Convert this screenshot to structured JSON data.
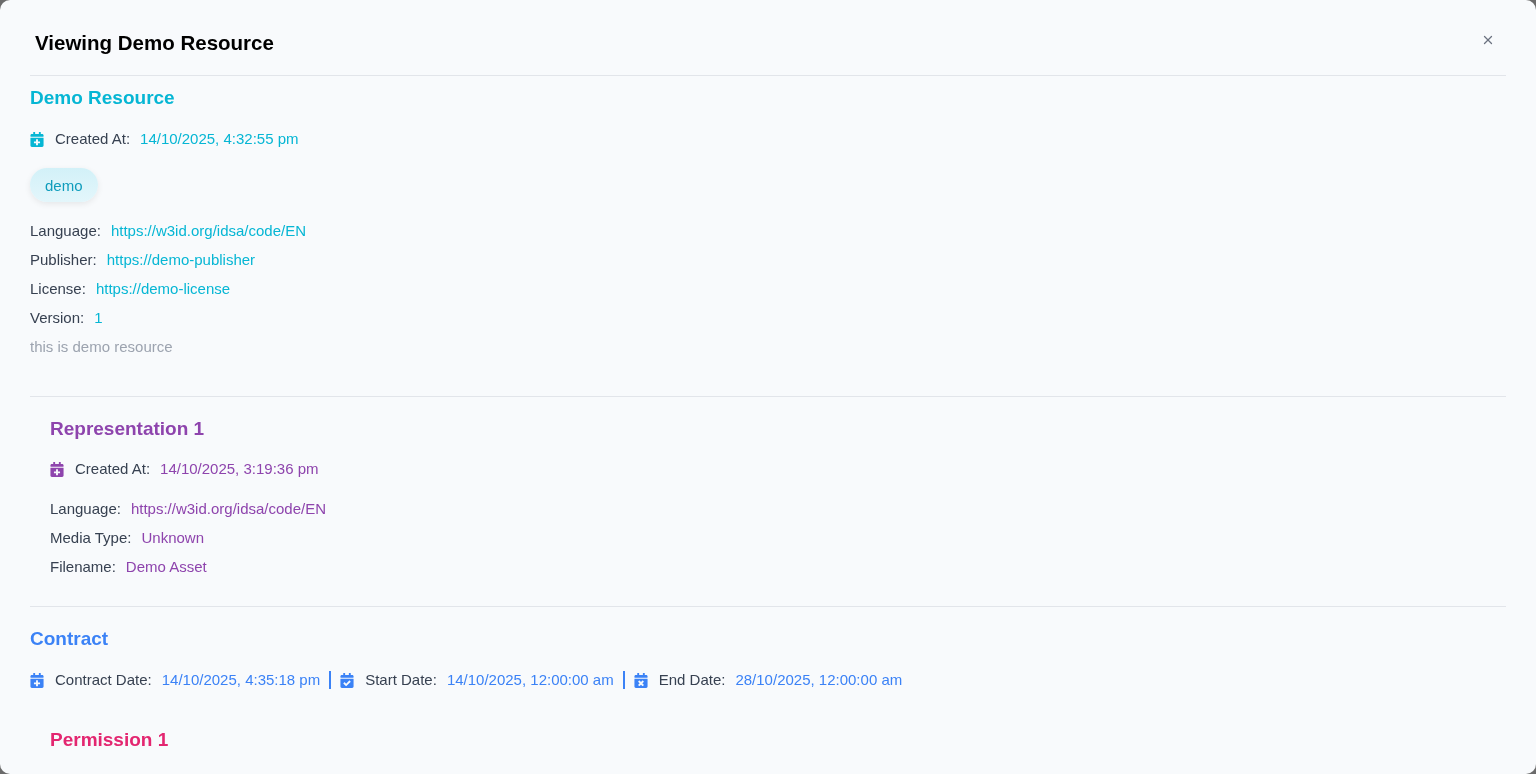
{
  "dialog": {
    "title": "Viewing Demo Resource"
  },
  "resource": {
    "title": "Demo Resource",
    "created": {
      "label": "Created At:",
      "value": "14/10/2025, 4:32:55 pm"
    },
    "tags": [
      "demo"
    ],
    "fields": [
      {
        "label": "Language:",
        "value": "https://w3id.org/idsa/code/EN"
      },
      {
        "label": "Publisher:",
        "value": "https://demo-publisher"
      },
      {
        "label": "License:",
        "value": "https://demo-license"
      },
      {
        "label": "Version:",
        "value": "1"
      }
    ],
    "description": "this is demo resource"
  },
  "representations": [
    {
      "title": "Representation 1",
      "created": {
        "label": "Created At:",
        "value": "14/10/2025, 3:19:36 pm"
      },
      "fields": [
        {
          "label": "Language:",
          "value": "https://w3id.org/idsa/code/EN"
        },
        {
          "label": "Media Type:",
          "value": "Unknown"
        },
        {
          "label": "Filename:",
          "value": "Demo Asset"
        }
      ]
    }
  ],
  "contract": {
    "title": "Contract",
    "dates": [
      {
        "kind": "created",
        "label": "Contract Date:",
        "value": "14/10/2025, 4:35:18 pm"
      },
      {
        "kind": "start",
        "label": "Start Date:",
        "value": "14/10/2025, 12:00:00 am"
      },
      {
        "kind": "end",
        "label": "End Date:",
        "value": "28/10/2025, 12:00:00 am"
      }
    ]
  },
  "permissions": [
    {
      "title": "Permission 1"
    }
  ]
}
